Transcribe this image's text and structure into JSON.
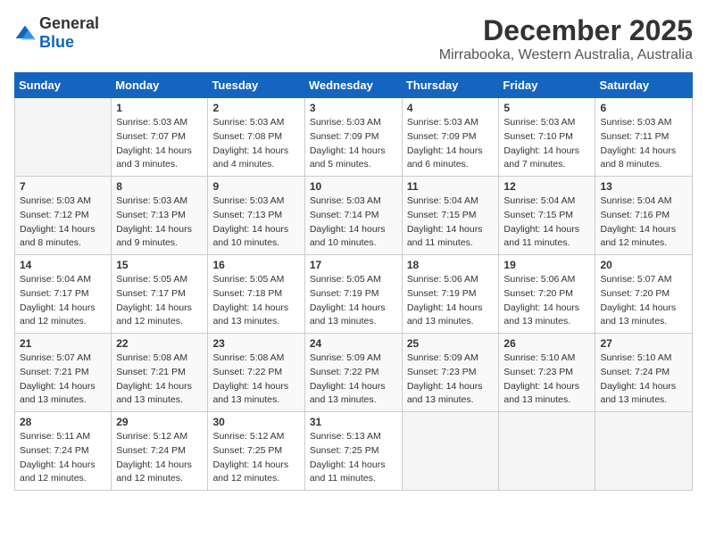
{
  "header": {
    "logo_general": "General",
    "logo_blue": "Blue",
    "title": "December 2025",
    "subtitle": "Mirrabooka, Western Australia, Australia"
  },
  "calendar": {
    "days_of_week": [
      "Sunday",
      "Monday",
      "Tuesday",
      "Wednesday",
      "Thursday",
      "Friday",
      "Saturday"
    ],
    "weeks": [
      [
        {
          "day": "",
          "info": ""
        },
        {
          "day": "1",
          "info": "Sunrise: 5:03 AM\nSunset: 7:07 PM\nDaylight: 14 hours\nand 3 minutes."
        },
        {
          "day": "2",
          "info": "Sunrise: 5:03 AM\nSunset: 7:08 PM\nDaylight: 14 hours\nand 4 minutes."
        },
        {
          "day": "3",
          "info": "Sunrise: 5:03 AM\nSunset: 7:09 PM\nDaylight: 14 hours\nand 5 minutes."
        },
        {
          "day": "4",
          "info": "Sunrise: 5:03 AM\nSunset: 7:09 PM\nDaylight: 14 hours\nand 6 minutes."
        },
        {
          "day": "5",
          "info": "Sunrise: 5:03 AM\nSunset: 7:10 PM\nDaylight: 14 hours\nand 7 minutes."
        },
        {
          "day": "6",
          "info": "Sunrise: 5:03 AM\nSunset: 7:11 PM\nDaylight: 14 hours\nand 8 minutes."
        }
      ],
      [
        {
          "day": "7",
          "info": "Sunrise: 5:03 AM\nSunset: 7:12 PM\nDaylight: 14 hours\nand 8 minutes."
        },
        {
          "day": "8",
          "info": "Sunrise: 5:03 AM\nSunset: 7:13 PM\nDaylight: 14 hours\nand 9 minutes."
        },
        {
          "day": "9",
          "info": "Sunrise: 5:03 AM\nSunset: 7:13 PM\nDaylight: 14 hours\nand 10 minutes."
        },
        {
          "day": "10",
          "info": "Sunrise: 5:03 AM\nSunset: 7:14 PM\nDaylight: 14 hours\nand 10 minutes."
        },
        {
          "day": "11",
          "info": "Sunrise: 5:04 AM\nSunset: 7:15 PM\nDaylight: 14 hours\nand 11 minutes."
        },
        {
          "day": "12",
          "info": "Sunrise: 5:04 AM\nSunset: 7:15 PM\nDaylight: 14 hours\nand 11 minutes."
        },
        {
          "day": "13",
          "info": "Sunrise: 5:04 AM\nSunset: 7:16 PM\nDaylight: 14 hours\nand 12 minutes."
        }
      ],
      [
        {
          "day": "14",
          "info": "Sunrise: 5:04 AM\nSunset: 7:17 PM\nDaylight: 14 hours\nand 12 minutes."
        },
        {
          "day": "15",
          "info": "Sunrise: 5:05 AM\nSunset: 7:17 PM\nDaylight: 14 hours\nand 12 minutes."
        },
        {
          "day": "16",
          "info": "Sunrise: 5:05 AM\nSunset: 7:18 PM\nDaylight: 14 hours\nand 13 minutes."
        },
        {
          "day": "17",
          "info": "Sunrise: 5:05 AM\nSunset: 7:19 PM\nDaylight: 14 hours\nand 13 minutes."
        },
        {
          "day": "18",
          "info": "Sunrise: 5:06 AM\nSunset: 7:19 PM\nDaylight: 14 hours\nand 13 minutes."
        },
        {
          "day": "19",
          "info": "Sunrise: 5:06 AM\nSunset: 7:20 PM\nDaylight: 14 hours\nand 13 minutes."
        },
        {
          "day": "20",
          "info": "Sunrise: 5:07 AM\nSunset: 7:20 PM\nDaylight: 14 hours\nand 13 minutes."
        }
      ],
      [
        {
          "day": "21",
          "info": "Sunrise: 5:07 AM\nSunset: 7:21 PM\nDaylight: 14 hours\nand 13 minutes."
        },
        {
          "day": "22",
          "info": "Sunrise: 5:08 AM\nSunset: 7:21 PM\nDaylight: 14 hours\nand 13 minutes."
        },
        {
          "day": "23",
          "info": "Sunrise: 5:08 AM\nSunset: 7:22 PM\nDaylight: 14 hours\nand 13 minutes."
        },
        {
          "day": "24",
          "info": "Sunrise: 5:09 AM\nSunset: 7:22 PM\nDaylight: 14 hours\nand 13 minutes."
        },
        {
          "day": "25",
          "info": "Sunrise: 5:09 AM\nSunset: 7:23 PM\nDaylight: 14 hours\nand 13 minutes."
        },
        {
          "day": "26",
          "info": "Sunrise: 5:10 AM\nSunset: 7:23 PM\nDaylight: 14 hours\nand 13 minutes."
        },
        {
          "day": "27",
          "info": "Sunrise: 5:10 AM\nSunset: 7:24 PM\nDaylight: 14 hours\nand 13 minutes."
        }
      ],
      [
        {
          "day": "28",
          "info": "Sunrise: 5:11 AM\nSunset: 7:24 PM\nDaylight: 14 hours\nand 12 minutes."
        },
        {
          "day": "29",
          "info": "Sunrise: 5:12 AM\nSunset: 7:24 PM\nDaylight: 14 hours\nand 12 minutes."
        },
        {
          "day": "30",
          "info": "Sunrise: 5:12 AM\nSunset: 7:25 PM\nDaylight: 14 hours\nand 12 minutes."
        },
        {
          "day": "31",
          "info": "Sunrise: 5:13 AM\nSunset: 7:25 PM\nDaylight: 14 hours\nand 11 minutes."
        },
        {
          "day": "",
          "info": ""
        },
        {
          "day": "",
          "info": ""
        },
        {
          "day": "",
          "info": ""
        }
      ]
    ]
  }
}
